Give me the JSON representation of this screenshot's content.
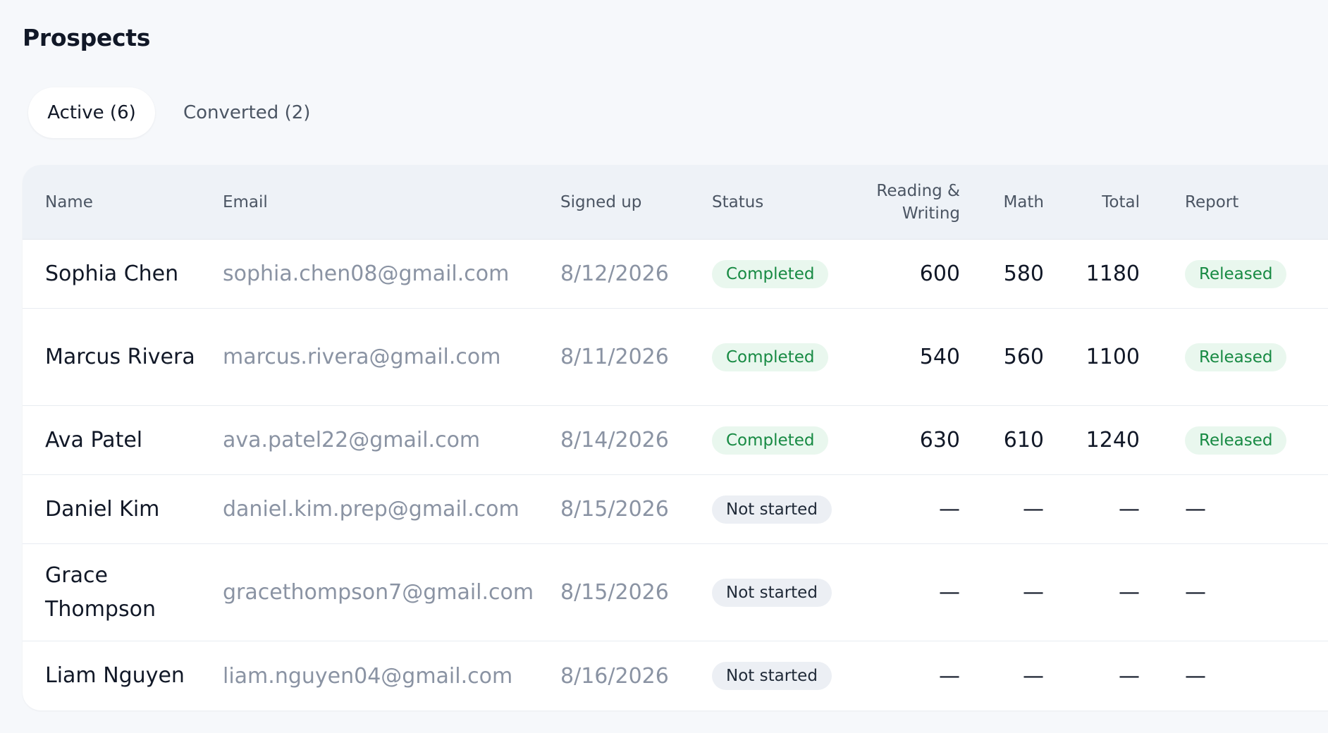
{
  "page": {
    "title": "Prospects"
  },
  "tabs": [
    {
      "label": "Active (6)",
      "active": true
    },
    {
      "label": "Converted (2)",
      "active": false
    }
  ],
  "table": {
    "columns": [
      "Name",
      "Email",
      "Signed up",
      "Status",
      "Reading & Writing",
      "Math",
      "Total",
      "Report"
    ],
    "rows": [
      {
        "name": "Sophia Chen",
        "email": "sophia.chen08@gmail.com",
        "signed_up": "8/12/2026",
        "status": "Completed",
        "rw": "600",
        "math": "580",
        "total": "1180",
        "report": "Released"
      },
      {
        "name": "Marcus Rivera",
        "email": "marcus.rivera@gmail.com",
        "signed_up": "8/11/2026",
        "status": "Completed",
        "rw": "540",
        "math": "560",
        "total": "1100",
        "report": "Released"
      },
      {
        "name": "Ava Patel",
        "email": "ava.patel22@gmail.com",
        "signed_up": "8/14/2026",
        "status": "Completed",
        "rw": "630",
        "math": "610",
        "total": "1240",
        "report": "Released"
      },
      {
        "name": "Daniel Kim",
        "email": "daniel.kim.prep@gmail.com",
        "signed_up": "8/15/2026",
        "status": "Not started",
        "rw": "—",
        "math": "—",
        "total": "—",
        "report": "—"
      },
      {
        "name": "Grace Thompson",
        "email": "gracethompson7@gmail.com",
        "signed_up": "8/15/2026",
        "status": "Not started",
        "rw": "—",
        "math": "—",
        "total": "—",
        "report": "—"
      },
      {
        "name": "Liam Nguyen",
        "email": "liam.nguyen04@gmail.com",
        "signed_up": "8/16/2026",
        "status": "Not started",
        "rw": "—",
        "math": "—",
        "total": "—",
        "report": "—"
      }
    ]
  },
  "colors": {
    "completed_badge_bg": "#e9f7ee",
    "completed_badge_text": "#178a43",
    "not_started_badge_bg": "#eceff4",
    "header_bg": "#eef2f7"
  }
}
